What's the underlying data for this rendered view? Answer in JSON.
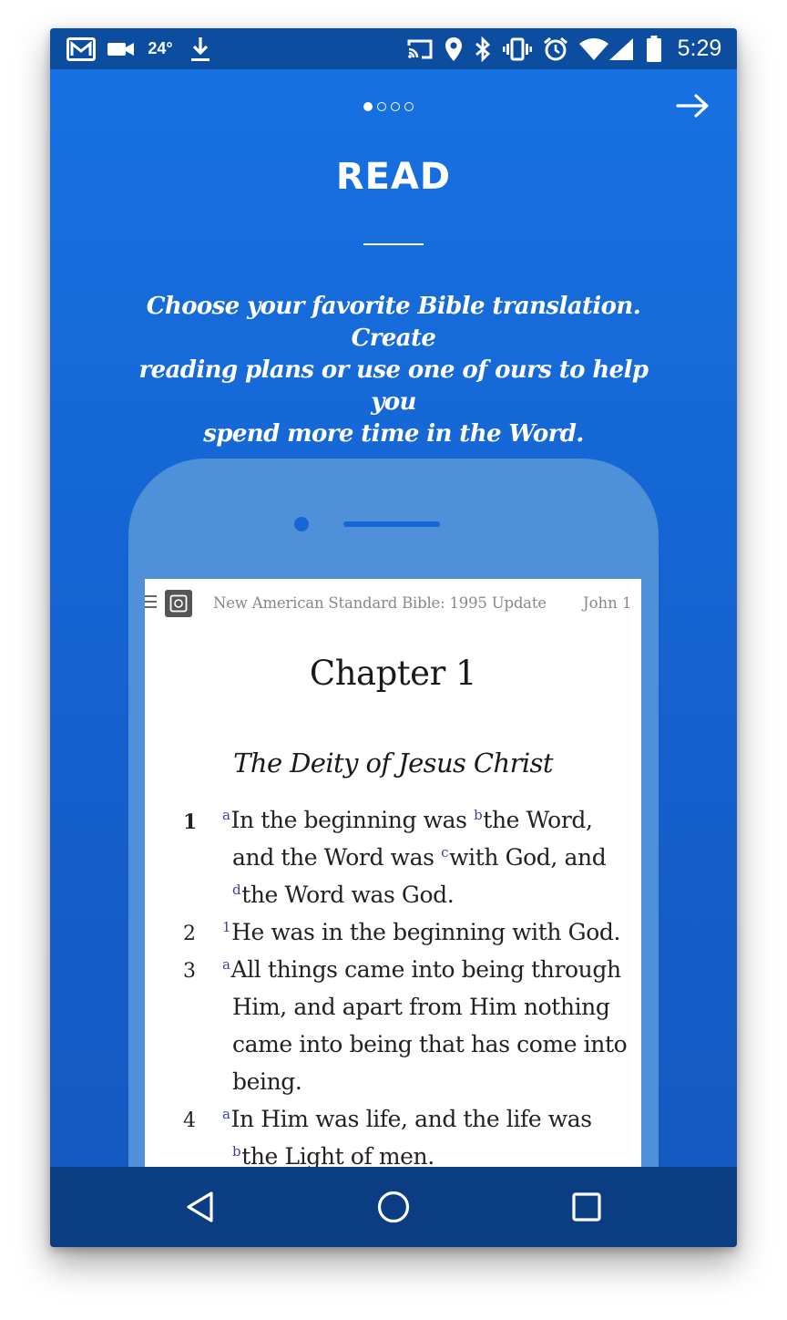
{
  "status_bar": {
    "temperature": "24°",
    "time": "5:29"
  },
  "pager": {
    "count": 4,
    "active": 0
  },
  "title": "READ",
  "description_lines": [
    "Choose your favorite Bible translation. Create",
    "reading plans or use one of ours to help you",
    "spend more time in the Word."
  ],
  "reader": {
    "bible_name": "New American Standard Bible: 1995 Update",
    "reference": "John 1",
    "chapter_title": "Chapter 1",
    "section_heading": "The Deity of Jesus Christ",
    "verses": [
      {
        "number": "1",
        "lines": [
          [
            {
              "fn": "a"
            },
            {
              "t": "In the beginning was "
            },
            {
              "fn": "b"
            },
            {
              "t": "the Word,"
            }
          ],
          [
            {
              "t": "and the Word was "
            },
            {
              "fn": "c"
            },
            {
              "t": "with God, and"
            }
          ],
          [
            {
              "fn": "d"
            },
            {
              "t": "the Word was God."
            }
          ]
        ]
      },
      {
        "number": "2",
        "lines": [
          [
            {
              "fn": "1"
            },
            {
              "t": "He was in the beginning with God."
            }
          ]
        ]
      },
      {
        "number": "3",
        "lines": [
          [
            {
              "fn": "a"
            },
            {
              "t": "All things came into being through"
            }
          ],
          [
            {
              "t": "Him, and apart from Him nothing"
            }
          ],
          [
            {
              "t": "came into being that has come into"
            }
          ],
          [
            {
              "t": "being."
            }
          ]
        ]
      },
      {
        "number": "4",
        "lines": [
          [
            {
              "fn": "a"
            },
            {
              "t": "In Him was life, and the life was"
            }
          ],
          [
            {
              "fn": "b"
            },
            {
              "t": "the Light of men."
            }
          ]
        ]
      }
    ]
  },
  "icons": {
    "status": [
      "gmail-icon",
      "video-camera-icon",
      "download-icon",
      "cast-icon",
      "location-pin-icon",
      "bluetooth-icon",
      "vibrate-icon",
      "alarm-icon",
      "wifi-icon",
      "cellular-signal-icon",
      "battery-icon"
    ],
    "next": "arrow-right-icon",
    "nav": [
      "back-icon",
      "home-icon",
      "recents-icon"
    ]
  },
  "colors": {
    "background": "#1672e3",
    "status_bar": "#0c4da0",
    "nav_bar": "#0b3d82",
    "phone_frame": "#4e91d9",
    "footnote": "#3b3fa5"
  }
}
